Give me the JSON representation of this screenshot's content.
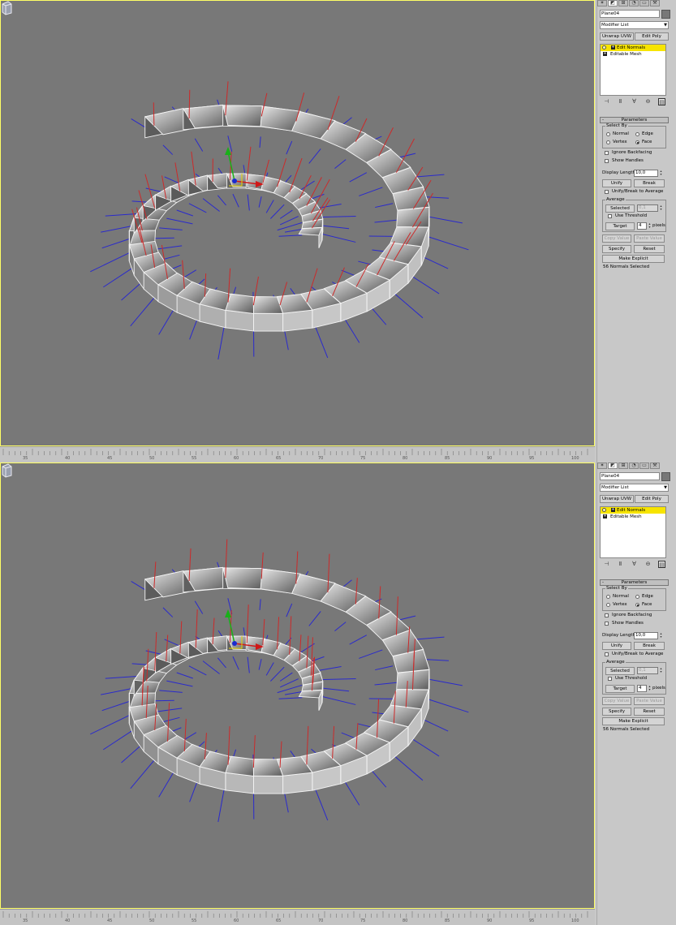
{
  "panes": [
    {
      "object_name": "Plane04",
      "modifier_list_label": "Modifier List",
      "buttons": {
        "unwrap": "Unwrap UVW",
        "edit_poly": "Edit Poly"
      },
      "stack": [
        {
          "label": "Edit Normals",
          "selected": true
        },
        {
          "label": "Editable Mesh",
          "selected": false
        }
      ],
      "rollout_title": "Parameters",
      "select_by": {
        "title": "Select By",
        "normal": "Normal",
        "edge": "Edge",
        "vertex": "Vertex",
        "face": "Face",
        "selected": "Face"
      },
      "ignore_backfacing": "Ignore Backfacing",
      "show_handles": "Show Handles",
      "display_length_label": "Display Length:",
      "display_length_value": "10,0",
      "unify": "Unify",
      "break": "Break",
      "unify_break_avg": "Unify/Break to Average",
      "average": {
        "title": "Average",
        "selected": "Selected",
        "selected_value": "0,1",
        "use_threshold": "Use Threshold",
        "target": "Target",
        "target_value": "4",
        "pixels": "pixels"
      },
      "copy_value": "Copy Value",
      "paste_value": "Paste Value",
      "specify": "Specify",
      "reset": "Reset",
      "make_explicit": "Make Explicit",
      "status": "56 Normals Selected"
    },
    {
      "object_name": "Plane04",
      "modifier_list_label": "Modifier List",
      "buttons": {
        "unwrap": "Unwrap UVW",
        "edit_poly": "Edit Poly"
      },
      "stack": [
        {
          "label": "Edit Normals",
          "selected": true
        },
        {
          "label": "Editable Mesh",
          "selected": false
        }
      ],
      "rollout_title": "Parameters",
      "select_by": {
        "title": "Select By",
        "normal": "Normal",
        "edge": "Edge",
        "vertex": "Vertex",
        "face": "Face",
        "selected": "Face"
      },
      "ignore_backfacing": "Ignore Backfacing",
      "show_handles": "Show Handles",
      "display_length_label": "Display Length:",
      "display_length_value": "10,0",
      "unify": "Unify",
      "break": "Break",
      "unify_break_avg": "Unify/Break to Average",
      "average": {
        "title": "Average",
        "selected": "Selected",
        "selected_value": "0,1",
        "use_threshold": "Use Threshold",
        "target": "Target",
        "target_value": "4",
        "pixels": "pixels"
      },
      "copy_value": "Copy Value",
      "paste_value": "Paste Value",
      "specify": "Specify",
      "reset": "Reset",
      "make_explicit": "Make Explicit",
      "status": "56 Normals Selected"
    }
  ],
  "ruler_ticks": [
    "35",
    "40",
    "45",
    "50",
    "55",
    "60",
    "65",
    "70",
    "75",
    "80",
    "85",
    "90",
    "95",
    "100"
  ],
  "colors": {
    "viewport_bg": "#787878",
    "normal_red": "#cc2a2a",
    "normal_blue": "#2a2acc",
    "selected_stack": "#f7e400",
    "viewport_border": "#ffff66"
  },
  "icons": [
    "light-bulb-icon",
    "pin-stack-icon",
    "show-end-result-icon",
    "make-unique-icon",
    "remove-modifier-icon",
    "configure-sets-icon",
    "viewcube-icon",
    "transform-gizmo-icon"
  ]
}
